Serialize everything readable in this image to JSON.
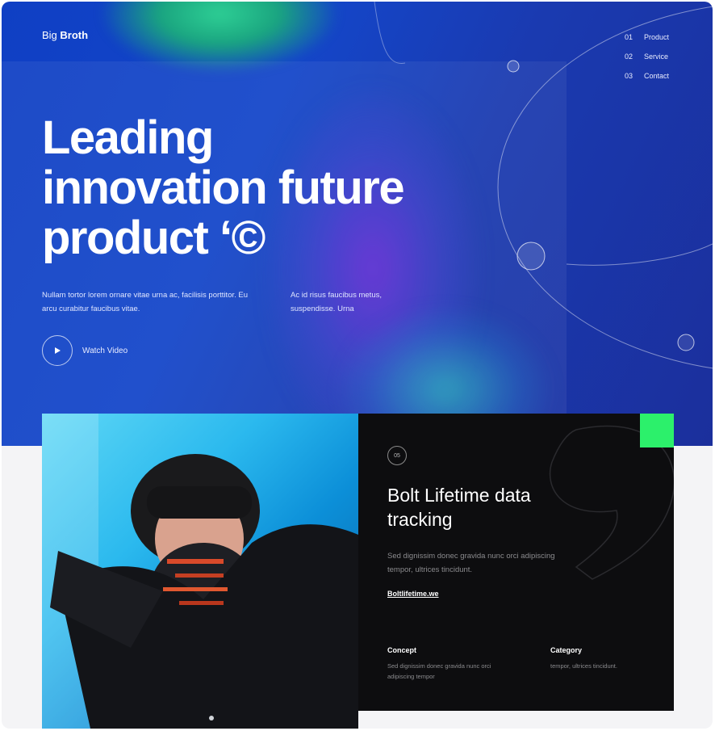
{
  "brand": {
    "prefix": "Big ",
    "name": "Broth"
  },
  "nav": [
    {
      "num": "01",
      "label": "Product"
    },
    {
      "num": "02",
      "label": "Service"
    },
    {
      "num": "03",
      "label": "Contact"
    }
  ],
  "hero": {
    "headline_line1": "Leading",
    "headline_line2": "innovation future",
    "headline_line3": "product ‘©",
    "desc_left": "Nullam tortor lorem ornare vitae urna ac, facilisis porttitor. Eu arcu curabitur faucibus vitae.",
    "desc_right": "Ac id risus faucibus metus, suspendisse. Urna",
    "watch_label": "Watch Video"
  },
  "card": {
    "badge": "05",
    "title_line1": "Bolt Lifetime data",
    "title_line2": "tracking",
    "description": "Sed dignissim donec gravida nunc orci adipiscing tempor, ultrices tincidunt.",
    "link": "Boltlifetime.we",
    "concept_heading": "Concept",
    "concept_text": "Sed dignissim donec gravida nunc orci adipiscing tempor",
    "category_heading": "Category",
    "category_text": "tempor, ultrices tincidunt."
  },
  "colors": {
    "hero_blue": "#1446c9",
    "accent_green": "#2cf06b",
    "card_dark": "#0d0d0f"
  },
  "icons": {
    "play": "play-icon",
    "badge": "number-badge-icon"
  }
}
